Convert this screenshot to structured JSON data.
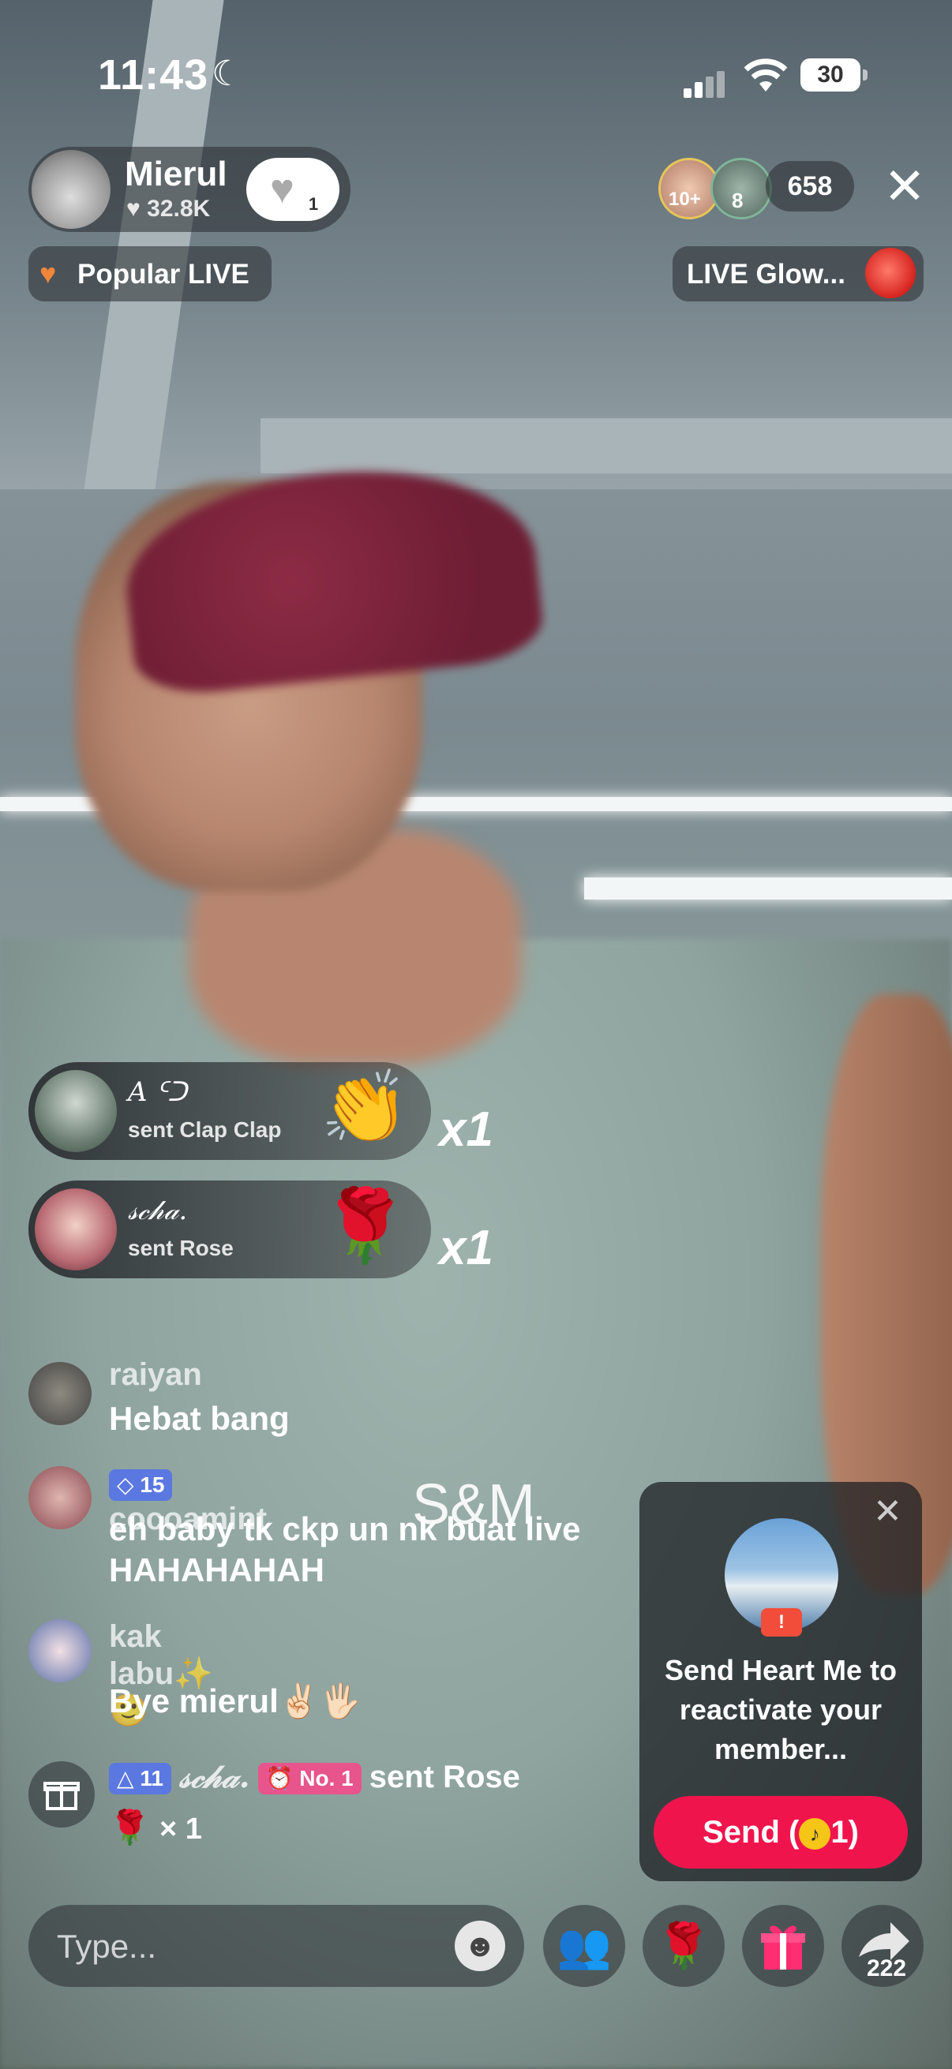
{
  "status_bar": {
    "time": "11:43",
    "battery": "30"
  },
  "host": {
    "name": "Mierul",
    "likes": "32.8K",
    "follow_badge": "1"
  },
  "viewers": {
    "badge_1": "10+",
    "badge_2": "8",
    "count": "658"
  },
  "tags": {
    "popular": "Popular LIVE",
    "glow": "LIVE Glow..."
  },
  "gift_notifications": [
    {
      "user": "𝐴 ᑦᑐ",
      "action": "sent Clap Clap",
      "combo": "x1"
    },
    {
      "user": "𝓈𝒸𝒽𝒶.",
      "action": "sent Rose",
      "combo": "x1"
    }
  ],
  "comments": [
    {
      "user": "raiyan",
      "message": "Hebat bang"
    },
    {
      "level": "15",
      "user": "cocoamint",
      "message": "eh baby tk ckp un nk buat live HAHAHAHAH"
    },
    {
      "user": "kak labu✨🙂",
      "message": "Bye mierul✌🏻🖐🏻"
    },
    {
      "level": "11",
      "user": "𝓈𝒸𝒽𝒶.",
      "rank": "No. 1",
      "action": "sent Rose",
      "gift_line": "× 1"
    }
  ],
  "overlay_text": "S&M",
  "membership_card": {
    "message": "Send Heart Me to reactivate your member...",
    "badge": "!",
    "send_label": "Send (",
    "send_coins": "1",
    "send_close": ")"
  },
  "input": {
    "placeholder": "Type..."
  },
  "share_count": "222",
  "icons": {
    "close": "close-icon",
    "heart": "heart-icon",
    "gift": "gift-icon",
    "rose": "rose-icon",
    "clap": "clap-icon",
    "emoji": "emoji-icon",
    "multi-guest": "multi-guest-icon",
    "share": "share-icon"
  },
  "colors": {
    "send_button": "#f0144d",
    "level_badge": "#5a78e0",
    "rank_badge": "#e8548c"
  }
}
